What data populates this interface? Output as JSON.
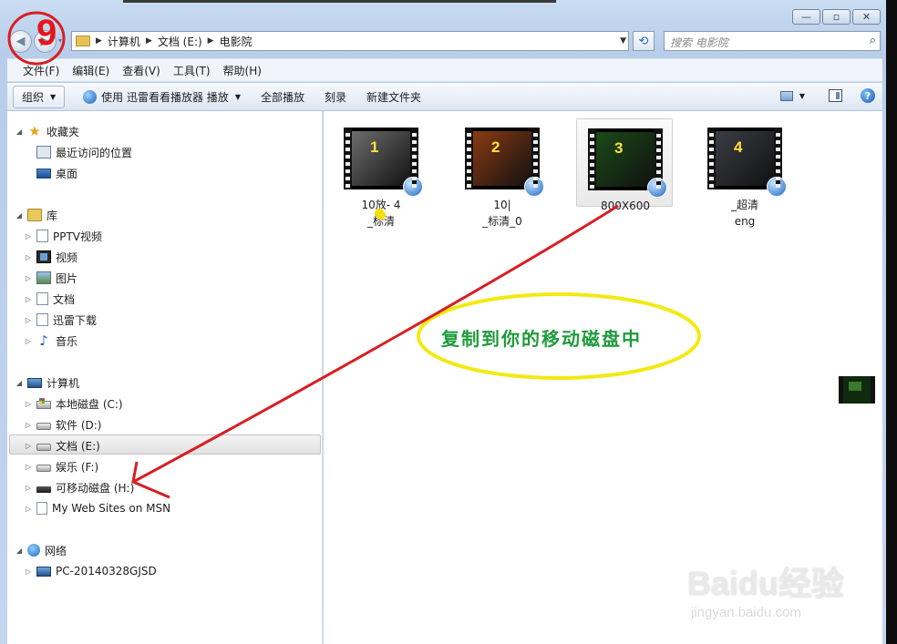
{
  "window": {
    "min_glyph": "—",
    "max_glyph": "▫",
    "close_glyph": "✕"
  },
  "navigation": {
    "back_glyph": "◀",
    "forward_glyph": "▶",
    "recent_glyph": "▾",
    "breadcrumbs": [
      "计算机",
      "文档 (E:)",
      "电影院"
    ],
    "address_dropdown_glyph": "▼",
    "refresh_glyph": "⟲",
    "search_placeholder": "搜索 电影院",
    "search_icon": "search-icon"
  },
  "menubar": {
    "items": [
      "文件(F)",
      "编辑(E)",
      "查看(V)",
      "工具(T)",
      "帮助(H)"
    ]
  },
  "toolbar": {
    "organize": "组织",
    "play_with": "使用 迅雷看看播放器 播放",
    "play_all": "全部播放",
    "burn": "刻录",
    "new_folder": "新建文件夹",
    "help_glyph": "?"
  },
  "navpane": {
    "favorites": "收藏夹",
    "recent_places": "最近访问的位置",
    "desktop": "桌面",
    "libraries": "库",
    "pptv": "PPTV视频",
    "videos": "视频",
    "pictures": "图片",
    "documents": "文档",
    "xunlei": "迅雷下载",
    "music": "音乐",
    "computer": "计算机",
    "drive_c": "本地磁盘 (C:)",
    "drive_d": "软件 (D:)",
    "drive_e": "文档 (E:)",
    "drive_f": "娱乐 (F:)",
    "drive_h": "可移动磁盘 (H:)",
    "msn": "My Web Sites on MSN",
    "network": "网络",
    "pc": "PC-20140328GJSD"
  },
  "files": [
    {
      "number": "1",
      "line1": "10放- 4",
      "line2": "_标清",
      "thumb_color": "#6d6d6d"
    },
    {
      "number": "2",
      "line1": "10|",
      "line2": "_标清_0",
      "thumb_color": "#8a3a12"
    },
    {
      "number": "3",
      "line1": "800X600",
      "line2": "",
      "thumb_color": "#1a4a18"
    },
    {
      "number": "4",
      "line1": "_超清",
      "line2": "eng",
      "thumb_color": "#3a3d45"
    }
  ],
  "annotation": {
    "step_number": "9",
    "callout": "复制到你的移动磁盘中"
  },
  "watermark": {
    "logo": "Baidu经验",
    "url": "jingyan.baidu.com"
  },
  "colors": {
    "annotation_red": "#d81e24",
    "callout_ellipse": "#f2ea12",
    "callout_text": "#1f9b3b"
  }
}
